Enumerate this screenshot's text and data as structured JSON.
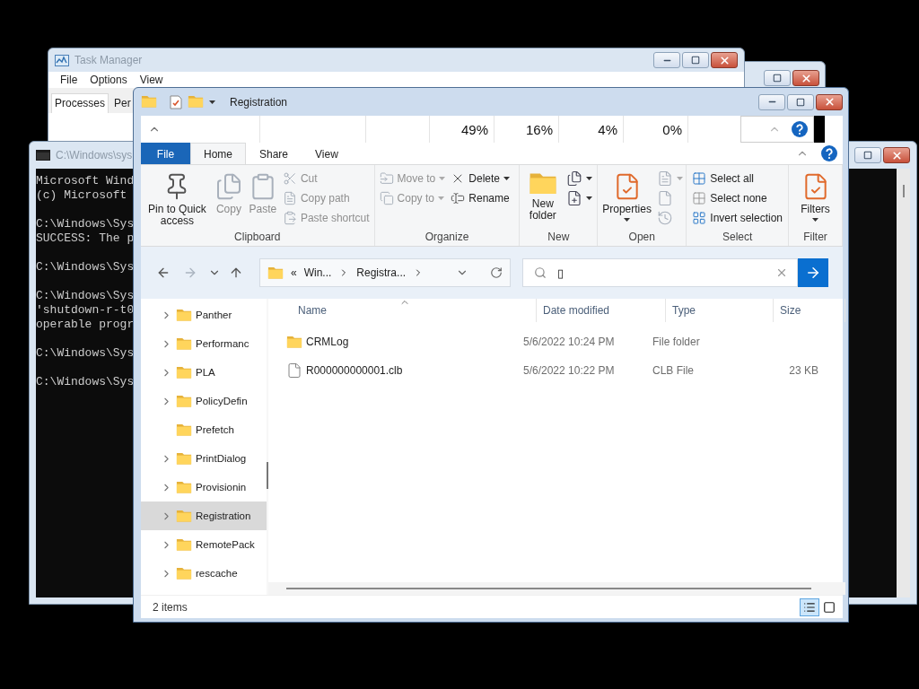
{
  "task_manager": {
    "title": "Task Manager",
    "menu": [
      "File",
      "Options",
      "View"
    ],
    "tabs": [
      {
        "label": "Processes",
        "selected": true
      },
      {
        "label": "Per",
        "selected": false
      }
    ]
  },
  "console": {
    "title": "C:\\Windows\\sys",
    "blocks": [
      [
        "Microsoft Wind",
        "(c) Microsoft"
      ],
      [
        "C:\\Windows\\Sys",
        "SUCCESS: The p"
      ],
      [
        "C:\\Windows\\Sys"
      ],
      [
        "C:\\Windows\\Sys",
        "'shutdown-r-t0",
        "operable progr"
      ],
      [
        "C:\\Windows\\Sys"
      ],
      [
        "C:\\Windows\\Sys"
      ]
    ]
  },
  "explorer": {
    "title": "Registration",
    "perf_strip": [
      "49%",
      "16%",
      "4%",
      "0%"
    ],
    "tabs": [
      {
        "label": "File",
        "kind": "menu",
        "selected": false
      },
      {
        "label": "Home",
        "kind": "tab",
        "selected": true
      },
      {
        "label": "Share",
        "kind": "tab",
        "selected": false
      },
      {
        "label": "View",
        "kind": "tab",
        "selected": false
      }
    ],
    "ribbon": [
      {
        "label": "Clipboard",
        "columns": [
          [
            {
              "kind": "large",
              "label": "Pin to Quick access",
              "disabled": false
            }
          ],
          [
            {
              "kind": "large",
              "label": "Copy",
              "disabled": true
            }
          ],
          [
            {
              "kind": "large",
              "label": "Paste",
              "disabled": true
            }
          ],
          [
            {
              "kind": "small",
              "label": "Cut",
              "disabled": true
            },
            {
              "kind": "small",
              "label": "Copy path",
              "disabled": true
            },
            {
              "kind": "small",
              "label": "Paste shortcut",
              "disabled": true
            }
          ]
        ]
      },
      {
        "label": "Organize",
        "columns": [
          [
            {
              "kind": "small",
              "label": "Move to",
              "disabled": true,
              "dropdown": true
            },
            {
              "kind": "small",
              "label": "Copy to",
              "disabled": true,
              "dropdown": true
            }
          ],
          [
            {
              "kind": "small",
              "label": "Delete",
              "disabled": false,
              "dropdown": true
            },
            {
              "kind": "small",
              "label": "Rename",
              "disabled": false
            }
          ]
        ]
      },
      {
        "label": "New",
        "columns": [
          [
            {
              "kind": "large",
              "label": "New folder",
              "disabled": false
            }
          ],
          [
            {
              "kind": "icon",
              "disabled": false,
              "dropdown": true
            },
            {
              "kind": "icon",
              "disabled": false,
              "dropdown": true
            }
          ]
        ]
      },
      {
        "label": "Open",
        "columns": [
          [
            {
              "kind": "large",
              "label": "Properties",
              "disabled": false,
              "dropdown": true
            }
          ],
          [
            {
              "kind": "icon",
              "disabled": true,
              "dropdown": true
            },
            {
              "kind": "icon",
              "disabled": true
            },
            {
              "kind": "icon",
              "disabled": true
            }
          ]
        ]
      },
      {
        "label": "Select",
        "columns": [
          [
            {
              "kind": "small",
              "label": "Select all",
              "disabled": false
            },
            {
              "kind": "small",
              "label": "Select none",
              "disabled": false
            },
            {
              "kind": "small",
              "label": "Invert selection",
              "disabled": false
            }
          ]
        ]
      },
      {
        "label": "Filter",
        "columns": [
          [
            {
              "kind": "large",
              "label": "Filters",
              "disabled": false,
              "dropdown": true
            }
          ]
        ]
      }
    ],
    "navigation": {
      "back_enabled": true,
      "forward_enabled": false
    },
    "address": {
      "overflow": "«",
      "crumbs": [
        "Win...",
        "Registra..."
      ]
    },
    "search": {
      "value": "▯"
    },
    "tree": [
      {
        "label": "Panther",
        "expandable": true,
        "selected": false
      },
      {
        "label": "Performanc",
        "expandable": true,
        "selected": false
      },
      {
        "label": "PLA",
        "expandable": true,
        "selected": false
      },
      {
        "label": "PolicyDefin",
        "expandable": true,
        "selected": false
      },
      {
        "label": "Prefetch",
        "expandable": false,
        "selected": false
      },
      {
        "label": "PrintDialog",
        "expandable": true,
        "selected": false
      },
      {
        "label": "Provisionin",
        "expandable": true,
        "selected": false
      },
      {
        "label": "Registration",
        "expandable": true,
        "selected": true
      },
      {
        "label": "RemotePack",
        "expandable": true,
        "selected": false
      },
      {
        "label": "rescache",
        "expandable": true,
        "selected": false
      }
    ],
    "columns": [
      "Name",
      "Date modified",
      "Type",
      "Size"
    ],
    "files": [
      {
        "kind": "folder",
        "name": "CRMLog",
        "date": "5/6/2022 10:24 PM",
        "type": "File folder"
      },
      {
        "kind": "file",
        "name": "R000000000001.clb",
        "date": "5/6/2022 10:22 PM",
        "type": "CLB File",
        "size": "23 KB"
      }
    ],
    "status": "2 items",
    "views": [
      {
        "selected": true
      },
      {
        "selected": false
      }
    ]
  }
}
